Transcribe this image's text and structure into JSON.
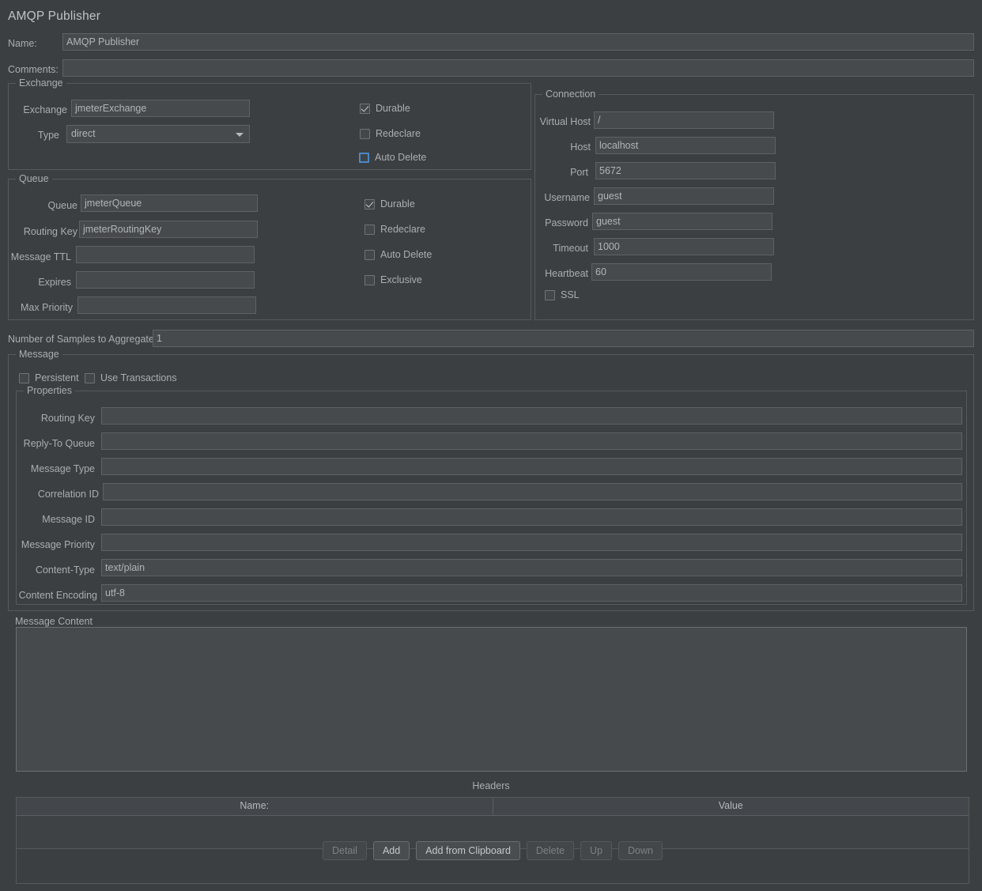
{
  "page_title": "AMQP Publisher",
  "top": {
    "name_label": "Name:",
    "name_value": "AMQP Publisher",
    "comments_label": "Comments:",
    "comments_value": ""
  },
  "exchange": {
    "title": "Exchange",
    "fields": [
      {
        "label": "Exchange",
        "value": "jmeterExchange"
      }
    ],
    "type_label": "Type",
    "type_value": "direct",
    "checkboxes": [
      {
        "label": "Durable",
        "checked": true,
        "focused": false
      },
      {
        "label": "Redeclare",
        "checked": false,
        "focused": false
      },
      {
        "label": "Auto Delete",
        "checked": false,
        "focused": true
      }
    ]
  },
  "queue": {
    "title": "Queue",
    "fields": [
      {
        "label": "Queue",
        "value": "jmeterQueue"
      },
      {
        "label": "Routing Key",
        "value": "jmeterRoutingKey"
      },
      {
        "label": "Message TTL",
        "value": ""
      },
      {
        "label": "Expires",
        "value": ""
      },
      {
        "label": "Max Priority",
        "value": ""
      }
    ],
    "checkboxes": [
      {
        "label": "Durable",
        "checked": true,
        "focused": false
      },
      {
        "label": "Redeclare",
        "checked": false,
        "focused": false
      },
      {
        "label": "Auto Delete",
        "checked": false,
        "focused": false
      },
      {
        "label": "Exclusive",
        "checked": false,
        "focused": false
      }
    ]
  },
  "connection": {
    "title": "Connection",
    "fields": [
      {
        "label": "Virtual Host",
        "value": "/"
      },
      {
        "label": "Host",
        "value": "localhost"
      },
      {
        "label": "Port",
        "value": "5672"
      },
      {
        "label": "Username",
        "value": "guest"
      },
      {
        "label": "Password",
        "value": "guest"
      },
      {
        "label": "Timeout",
        "value": "1000"
      },
      {
        "label": "Heartbeat",
        "value": "60"
      }
    ],
    "ssl": {
      "label": "SSL",
      "checked": false
    }
  },
  "aggregate": {
    "label": "Number of Samples to Aggregate",
    "value": "1"
  },
  "message": {
    "title": "Message",
    "checkboxes": [
      {
        "label": "Persistent",
        "checked": false
      },
      {
        "label": "Use Transactions",
        "checked": false
      }
    ],
    "properties": {
      "title": "Properties",
      "fields": [
        {
          "label": "Routing Key",
          "value": ""
        },
        {
          "label": "Reply-To Queue",
          "value": ""
        },
        {
          "label": "Message Type",
          "value": ""
        },
        {
          "label": "Correlation ID",
          "value": ""
        },
        {
          "label": "Message ID",
          "value": ""
        },
        {
          "label": "Message Priority",
          "value": ""
        },
        {
          "label": "Content-Type",
          "value": "text/plain"
        },
        {
          "label": "Content Encoding",
          "value": "utf-8"
        }
      ]
    }
  },
  "message_content": {
    "label": "Message Content",
    "value": ""
  },
  "headers": {
    "caption": "Headers",
    "columns": [
      "Name:",
      "Value"
    ],
    "rows": [],
    "buttons": [
      {
        "label": "Detail",
        "enabled": false
      },
      {
        "label": "Add",
        "enabled": true
      },
      {
        "label": "Add from Clipboard",
        "enabled": true
      },
      {
        "label": "Delete",
        "enabled": false
      },
      {
        "label": "Up",
        "enabled": false
      },
      {
        "label": "Down",
        "enabled": false
      }
    ]
  },
  "colors": {
    "panel_bg": "#3c3f41",
    "field_bg": "#474a4c",
    "field_border": "#5e6264",
    "group_border": "#555a5c",
    "text": "#a9aeb1",
    "focus_blue": "#4b88c8"
  }
}
